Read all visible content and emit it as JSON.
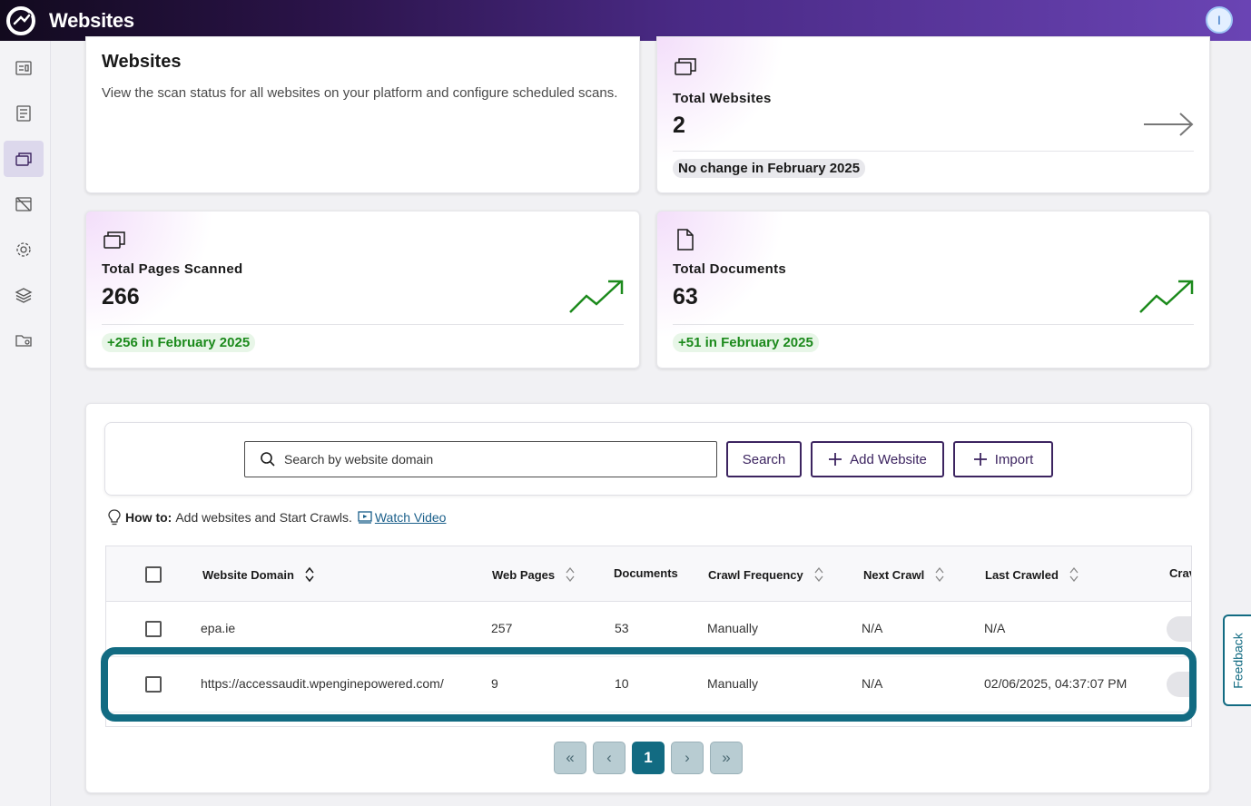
{
  "app": {
    "title": "Websites",
    "avatar_initial": "I"
  },
  "sidebar": {
    "items": [
      {
        "name": "dashboard",
        "icon": "dashboard-icon"
      },
      {
        "name": "reports",
        "icon": "report-icon"
      },
      {
        "name": "websites",
        "icon": "windows-icon",
        "active": true
      },
      {
        "name": "hidden",
        "icon": "browser-off-icon"
      },
      {
        "name": "settings",
        "icon": "gear-icon"
      },
      {
        "name": "layers",
        "icon": "layers-icon"
      },
      {
        "name": "folder",
        "icon": "folder-settings-icon"
      }
    ]
  },
  "intro": {
    "title": "Websites",
    "description": "View the scan status for all websites on your platform and configure scheduled scans."
  },
  "stats": {
    "websites": {
      "label": "Total Websites",
      "value": "2",
      "note": "No change in February 2025"
    },
    "pages": {
      "label": "Total Pages Scanned",
      "value": "266",
      "note": "+256 in February 2025"
    },
    "documents": {
      "label": "Total Documents",
      "value": "63",
      "note": "+51 in February 2025"
    }
  },
  "search": {
    "placeholder": "Search by website domain",
    "search_label": "Search",
    "add_label": "Add Website",
    "import_label": "Import"
  },
  "howto": {
    "prefix": "How to:",
    "text": "Add websites and Start Crawls.",
    "link": "Watch Video"
  },
  "table": {
    "columns": [
      "Website Domain",
      "Web Pages",
      "Documents",
      "Crawl Frequency",
      "Next Crawl",
      "Last Crawled",
      "Crav"
    ],
    "rows": [
      {
        "domain": "epa.ie",
        "pages": "257",
        "documents": "53",
        "frequency": "Manually",
        "next": "N/A",
        "last": "N/A"
      },
      {
        "domain": "https://accessaudit.wpenginepowered.com/",
        "pages": "9",
        "documents": "10",
        "frequency": "Manually",
        "next": "N/A",
        "last": "02/06/2025, 04:37:07 PM"
      }
    ]
  },
  "pagination": {
    "first": "«",
    "prev": "‹",
    "current": "1",
    "next": "›",
    "last": "»"
  },
  "feedback": "Feedback",
  "colors": {
    "accent": "#126b82",
    "brand": "#3c2460",
    "positive": "#1c8a1c"
  }
}
